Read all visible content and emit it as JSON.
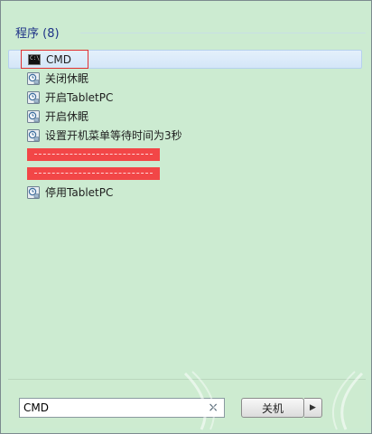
{
  "group": {
    "title": "程序 (8)"
  },
  "programs": [
    {
      "label": "CMD",
      "icon": "cmd-icon"
    },
    {
      "label": "关闭休眠",
      "icon": "scheduled-task-icon"
    },
    {
      "label": "开启TabletPC",
      "icon": "scheduled-task-icon"
    },
    {
      "label": "开启休眠",
      "icon": "scheduled-task-icon"
    },
    {
      "label": "设置开机菜单等待时间为3秒",
      "icon": "scheduled-task-icon"
    },
    {
      "label": "停用TabletPC",
      "icon": "scheduled-task-icon"
    }
  ],
  "search": {
    "value": "CMD",
    "clear_glyph": "×"
  },
  "shutdown": {
    "label": "关机"
  },
  "colors": {
    "panel": "#ccebd1",
    "selection_box": "#e03030",
    "redaction": "#f24647",
    "group_title": "#1e3287"
  }
}
